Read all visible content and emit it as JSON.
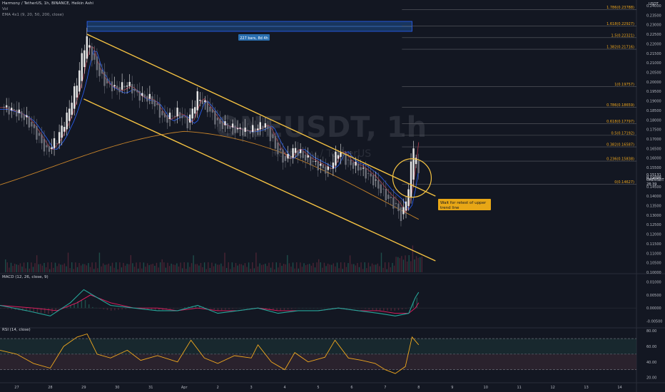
{
  "header": {
    "symbol_line": "Harmony / TetherUS, 1h, BINANCE, Heikin Ashi",
    "vol_label": "Vol",
    "ema_label": "EMA 4x1 (9, 20, 50, 200, close)"
  },
  "watermark": {
    "ticker": "ONEUSDT, 1h",
    "name": "Harmony / TetherUS"
  },
  "colors": {
    "background": "#131722",
    "up": "#e8e8e8",
    "down": "#6b6e78",
    "channel": "#f5c242",
    "fib": "#f0a81e",
    "ema_blue": "#2962ff",
    "ema_orange": "#c8842a",
    "ema_red": "#b43c4c",
    "macd": "#26a69a",
    "signal": "#e91e63",
    "rsi": "#f0a81e",
    "rsi_band": "#1e3a3a",
    "range_box": "#1e5aa8"
  },
  "chart_data": [
    {
      "type": "candlestick",
      "title": "Harmony / TetherUS, 1h, BINANCE, Heikin Ashi",
      "y_axis_unit": "USDT",
      "ylim": [
        0.1,
        0.24
      ],
      "y_ticks": [
        "0.24000",
        "0.23500",
        "0.23000",
        "0.22500",
        "0.22000",
        "0.21500",
        "0.21000",
        "0.20500",
        "0.20000",
        "0.19500",
        "0.19000",
        "0.18500",
        "0.18000",
        "0.17500",
        "0.17000",
        "0.16500",
        "0.16000",
        "0.15500",
        "0.15000",
        "0.14500",
        "0.14000",
        "0.13500",
        "0.13000",
        "0.12500",
        "0.12000",
        "0.11500",
        "0.11000",
        "0.10500",
        "0.10000"
      ],
      "x_ticks": [
        "27",
        "28",
        "29",
        "30",
        "31",
        "Apr",
        "2",
        "3",
        "4",
        "5",
        "6",
        "7",
        "8",
        "9",
        "10",
        "11",
        "12",
        "13",
        "14"
      ],
      "x_tick_positions": [
        0,
        1,
        2,
        3,
        4,
        5,
        6,
        7,
        8,
        9,
        10,
        11,
        12,
        13,
        14,
        15,
        16,
        17,
        18
      ],
      "x_range": [
        -0.5,
        18.5
      ],
      "price_path": [
        [
          -0.5,
          0.187
        ],
        [
          0,
          0.184
        ],
        [
          0.3,
          0.18
        ],
        [
          0.6,
          0.172
        ],
        [
          0.9,
          0.163
        ],
        [
          1.2,
          0.17
        ],
        [
          1.5,
          0.182
        ],
        [
          1.8,
          0.2
        ],
        [
          2.0,
          0.218
        ],
        [
          2.1,
          0.223
        ],
        [
          2.3,
          0.21
        ],
        [
          2.6,
          0.2
        ],
        [
          3.0,
          0.196
        ],
        [
          3.3,
          0.199
        ],
        [
          3.6,
          0.193
        ],
        [
          4.0,
          0.191
        ],
        [
          4.4,
          0.18
        ],
        [
          4.8,
          0.184
        ],
        [
          5.1,
          0.178
        ],
        [
          5.4,
          0.193
        ],
        [
          5.7,
          0.186
        ],
        [
          6.0,
          0.178
        ],
        [
          6.4,
          0.176
        ],
        [
          6.8,
          0.174
        ],
        [
          7.1,
          0.175
        ],
        [
          7.4,
          0.178
        ],
        [
          7.7,
          0.166
        ],
        [
          8.0,
          0.158
        ],
        [
          8.3,
          0.165
        ],
        [
          8.6,
          0.16
        ],
        [
          9.0,
          0.156
        ],
        [
          9.3,
          0.153
        ],
        [
          9.6,
          0.164
        ],
        [
          9.9,
          0.157
        ],
        [
          10.2,
          0.155
        ],
        [
          10.6,
          0.149
        ],
        [
          11.0,
          0.14
        ],
        [
          11.3,
          0.135
        ],
        [
          11.5,
          0.128
        ],
        [
          11.7,
          0.145
        ],
        [
          11.85,
          0.168
        ],
        [
          12.0,
          0.15
        ]
      ],
      "annotations": {
        "bars_range": "227 bars, 8d 4h",
        "wait_note": "Wait for retest of upper trend line"
      },
      "fib_levels": [
        {
          "label": "1.786(0.23788)",
          "ratio": 1.786,
          "price": 0.23788
        },
        {
          "label": "1.618(0.22927)",
          "ratio": 1.618,
          "price": 0.22927
        },
        {
          "label": "1.5(0.22321)",
          "ratio": 1.5,
          "price": 0.22321
        },
        {
          "label": "1.382(0.21716)",
          "ratio": 1.382,
          "price": 0.21716
        },
        {
          "label": "1(0.19757)",
          "ratio": 1,
          "price": 0.19757
        },
        {
          "label": "0.786(0.18659)",
          "ratio": 0.786,
          "price": 0.18659
        },
        {
          "label": "0.618(0.17797)",
          "ratio": 0.618,
          "price": 0.17797
        },
        {
          "label": "0.5(0.17192)",
          "ratio": 0.5,
          "price": 0.17192
        },
        {
          "label": "0.382(0.16587)",
          "ratio": 0.382,
          "price": 0.16587
        },
        {
          "label": "0.236(0.15838)",
          "ratio": 0.236,
          "price": 0.15838
        },
        {
          "label": "0(0.14627)",
          "ratio": 0,
          "price": 0.14627
        }
      ],
      "channel_upper": [
        [
          2.1,
          0.225
        ],
        [
          12.5,
          0.14
        ]
      ],
      "channel_lower": [
        [
          2.0,
          0.191
        ],
        [
          12.5,
          0.106
        ]
      ],
      "price_labels": [
        {
          "text": "0.15131",
          "price": 0.15131
        },
        {
          "text": "ONEUSDT",
          "price": 0.1486
        },
        {
          "text": "0.14945",
          "price": 0.14945
        },
        {
          "text": "28:39",
          "price": 0.1464
        }
      ]
    },
    {
      "type": "line",
      "title": "MACD (12, 26, close, 9)",
      "ylim": [
        -0.007,
        0.012
      ],
      "y_ticks": [
        "0.01000",
        "0.00500",
        "0.00000",
        "-0.00500"
      ],
      "series": [
        {
          "name": "MACD",
          "points": [
            [
              -0.5,
              0.001
            ],
            [
              0.3,
              -0.001
            ],
            [
              1.0,
              -0.003
            ],
            [
              1.6,
              0.002
            ],
            [
              2.0,
              0.007
            ],
            [
              2.4,
              0.004
            ],
            [
              2.8,
              0.001
            ],
            [
              3.5,
              0.0
            ],
            [
              4.2,
              -0.001
            ],
            [
              4.8,
              -0.001
            ],
            [
              5.4,
              0.001
            ],
            [
              6.0,
              -0.002
            ],
            [
              6.6,
              -0.001
            ],
            [
              7.2,
              0.0
            ],
            [
              7.8,
              -0.002
            ],
            [
              8.4,
              -0.001
            ],
            [
              9.0,
              -0.001
            ],
            [
              9.6,
              0.0
            ],
            [
              10.2,
              -0.001
            ],
            [
              10.8,
              -0.002
            ],
            [
              11.3,
              -0.003
            ],
            [
              11.7,
              -0.002
            ],
            [
              11.9,
              0.004
            ],
            [
              12.0,
              0.006
            ]
          ]
        },
        {
          "name": "Signal",
          "points": [
            [
              -0.5,
              0.001
            ],
            [
              0.5,
              0.0
            ],
            [
              1.2,
              -0.001
            ],
            [
              1.8,
              0.002
            ],
            [
              2.2,
              0.005
            ],
            [
              2.8,
              0.002
            ],
            [
              3.5,
              0.0
            ],
            [
              4.2,
              0.0
            ],
            [
              4.8,
              -0.001
            ],
            [
              5.4,
              0.0
            ],
            [
              6.0,
              -0.001
            ],
            [
              6.6,
              -0.001
            ],
            [
              7.2,
              0.0
            ],
            [
              7.8,
              -0.001
            ],
            [
              8.4,
              -0.001
            ],
            [
              9.0,
              -0.001
            ],
            [
              9.6,
              0.0
            ],
            [
              10.2,
              -0.001
            ],
            [
              10.8,
              -0.001
            ],
            [
              11.3,
              -0.002
            ],
            [
              11.7,
              -0.002
            ],
            [
              11.9,
              0.0
            ],
            [
              12.0,
              0.002
            ]
          ]
        }
      ]
    },
    {
      "type": "line",
      "title": "RSI (14, close)",
      "ylim": [
        15,
        82
      ],
      "y_ticks": [
        "80.00",
        "60.00",
        "40.00",
        "20.00"
      ],
      "bands": [
        70,
        50,
        30
      ],
      "series": [
        {
          "name": "RSI",
          "points": [
            [
              -0.5,
              55
            ],
            [
              0,
              50
            ],
            [
              0.5,
              38
            ],
            [
              1.0,
              32
            ],
            [
              1.4,
              60
            ],
            [
              1.8,
              72
            ],
            [
              2.1,
              76
            ],
            [
              2.4,
              50
            ],
            [
              2.8,
              45
            ],
            [
              3.3,
              55
            ],
            [
              3.7,
              42
            ],
            [
              4.2,
              48
            ],
            [
              4.8,
              40
            ],
            [
              5.2,
              68
            ],
            [
              5.6,
              45
            ],
            [
              6.0,
              38
            ],
            [
              6.5,
              48
            ],
            [
              7.0,
              45
            ],
            [
              7.2,
              62
            ],
            [
              7.6,
              40
            ],
            [
              8.0,
              30
            ],
            [
              8.3,
              52
            ],
            [
              8.7,
              40
            ],
            [
              9.2,
              46
            ],
            [
              9.5,
              68
            ],
            [
              9.9,
              45
            ],
            [
              10.3,
              42
            ],
            [
              10.7,
              38
            ],
            [
              11.0,
              30
            ],
            [
              11.3,
              25
            ],
            [
              11.6,
              34
            ],
            [
              11.8,
              72
            ],
            [
              12.0,
              62
            ]
          ]
        }
      ]
    }
  ]
}
